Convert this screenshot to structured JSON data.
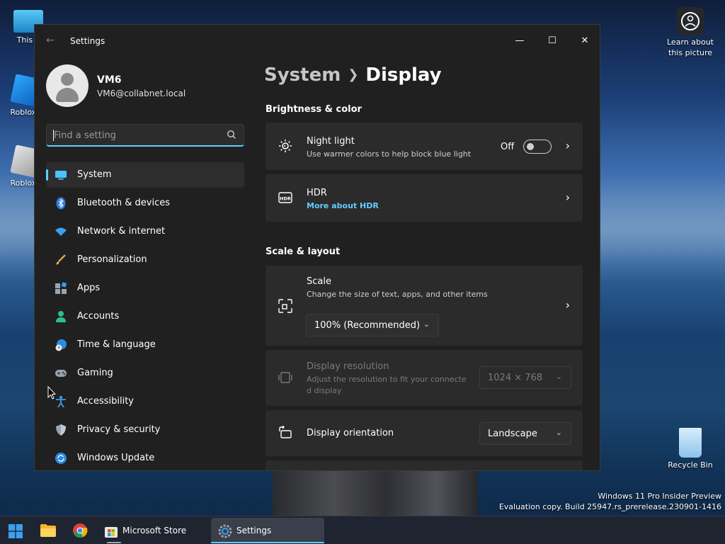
{
  "desktop": {
    "icons": [
      {
        "label": "This P",
        "name": "desktop-icon-this-pc"
      },
      {
        "label": "Roblox S",
        "name": "desktop-icon-roblox-studio"
      },
      {
        "label": "Roblox P",
        "name": "desktop-icon-roblox-player"
      },
      {
        "label": "Recycle Bin",
        "name": "desktop-icon-recycle-bin"
      }
    ],
    "learn_about_picture": "Learn about\nthis picture",
    "watermark_line1": "Windows 11 Pro Insider Preview",
    "watermark_line2": "Evaluation copy. Build 25947.rs_prerelease.230901-1416"
  },
  "window": {
    "title": "Settings",
    "controls": {
      "minimize": "—",
      "maximize": "☐",
      "close": "✕"
    }
  },
  "user": {
    "name": "VM6",
    "email": "VM6@collabnet.local"
  },
  "search": {
    "placeholder": "Find a setting"
  },
  "sidebar": {
    "items": [
      {
        "label": "System",
        "icon": "monitor-icon",
        "active": true
      },
      {
        "label": "Bluetooth & devices",
        "icon": "bluetooth-icon"
      },
      {
        "label": "Network & internet",
        "icon": "wifi-icon"
      },
      {
        "label": "Personalization",
        "icon": "brush-icon"
      },
      {
        "label": "Apps",
        "icon": "apps-icon"
      },
      {
        "label": "Accounts",
        "icon": "account-icon"
      },
      {
        "label": "Time & language",
        "icon": "globe-clock-icon"
      },
      {
        "label": "Gaming",
        "icon": "gamepad-icon"
      },
      {
        "label": "Accessibility",
        "icon": "accessibility-icon"
      },
      {
        "label": "Privacy & security",
        "icon": "shield-icon"
      },
      {
        "label": "Windows Update",
        "icon": "update-icon"
      }
    ]
  },
  "main": {
    "breadcrumb_parent": "System",
    "breadcrumb_current": "Display",
    "sections": {
      "brightness": "Brightness & color",
      "scale_layout": "Scale & layout"
    },
    "night_light": {
      "title": "Night light",
      "subtitle": "Use warmer colors to help block blue light",
      "state": "Off"
    },
    "hdr": {
      "title": "HDR",
      "link": "More about HDR"
    },
    "scale": {
      "title": "Scale",
      "subtitle": "Change the size of text, apps, and other items",
      "value": "100% (Recommended)"
    },
    "resolution": {
      "title": "Display resolution",
      "subtitle_line1": "Adjust the resolution to fit your connecte",
      "subtitle_line2": "d display",
      "value": "1024 × 768"
    },
    "orientation": {
      "title": "Display orientation",
      "value": "Landscape"
    }
  },
  "taskbar": {
    "items": [
      {
        "label": "",
        "name": "start-button"
      },
      {
        "label": "",
        "name": "file-explorer-button"
      },
      {
        "label": "",
        "name": "chrome-button"
      },
      {
        "label": "Microsoft Store",
        "name": "microsoft-store-button"
      },
      {
        "label": "Settings",
        "name": "settings-taskbar-button",
        "active": true
      }
    ]
  },
  "colors": {
    "accent": "#60cdff",
    "window_bg": "#202020",
    "card_bg": "#2b2b2b"
  }
}
